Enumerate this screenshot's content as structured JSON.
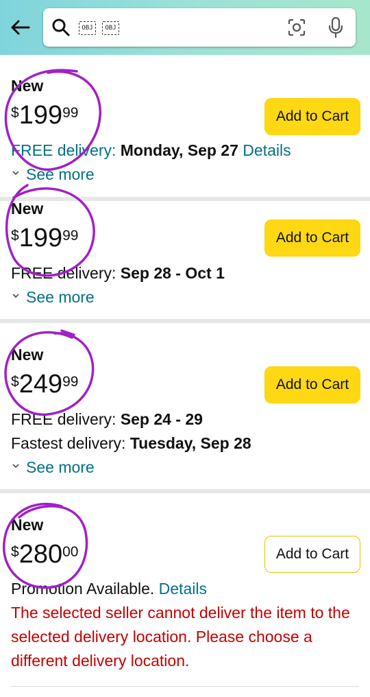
{
  "search": {
    "back_icon": "arrow-left-icon",
    "search_icon": "search-icon",
    "obj_chips": [
      "OBJ",
      "OBJ"
    ],
    "camera_icon": "lens-camera-icon",
    "mic_icon": "microphone-icon"
  },
  "offers": [
    {
      "condition": "New",
      "price_symbol": "$",
      "price_whole": "199",
      "price_fraction": "99",
      "button": "Add to Cart",
      "delivery_label": "FREE delivery: ",
      "delivery_date": "Monday, Sep 27",
      "details_link": "Details",
      "see_more": "See more"
    },
    {
      "condition": "New",
      "price_symbol": "$",
      "price_whole": "199",
      "price_fraction": "99",
      "button": "Add to Cart",
      "delivery_label": "FREE delivery: ",
      "delivery_date": "Sep 28 - Oct 1",
      "see_more": "See more"
    },
    {
      "condition": "New",
      "price_symbol": "$",
      "price_whole": "249",
      "price_fraction": "99",
      "button": "Add to Cart",
      "delivery_label": "FREE delivery: ",
      "delivery_date": "Sep 24 - 29",
      "fastest_label": "Fastest delivery: ",
      "fastest_date": "Tuesday, Sep 28",
      "see_more": "See more"
    },
    {
      "condition": "New",
      "price_symbol": "$",
      "price_whole": "280",
      "price_fraction": "00",
      "button": "Add to Cart",
      "promotion_text": "Promotion Available. ",
      "promotion_link": "Details",
      "error": "The selected seller cannot deliver the item to the selected delivery location. Please choose a different delivery location."
    }
  ],
  "colors": {
    "link": "#007185",
    "button_yellow": "#ffd814",
    "error_red": "#c40000",
    "annotation_purple": "#a020c8"
  }
}
